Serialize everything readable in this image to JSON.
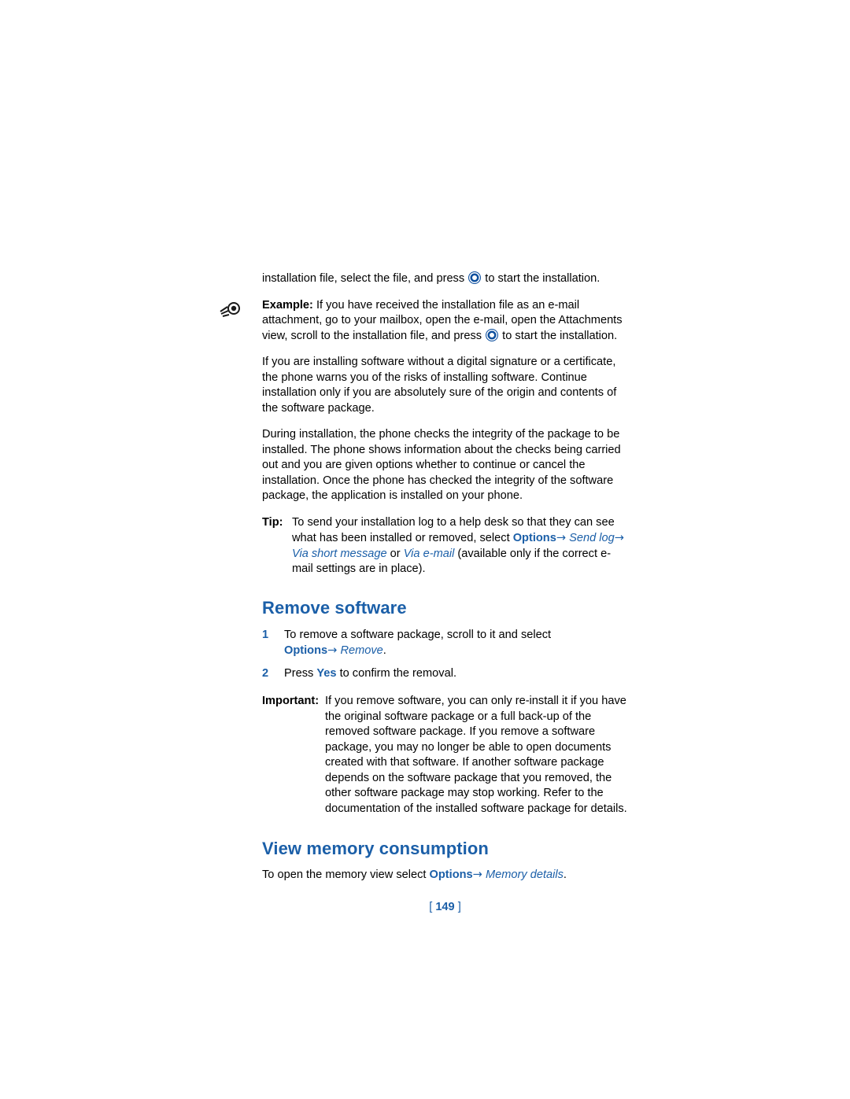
{
  "doc": {
    "intro_line_before": "installation file, select the file, and press",
    "intro_line_after": "to start the installation.",
    "example": {
      "label": "Example:",
      "text_1": " If you have received the installation file as an e-mail attachment, go to your mailbox, open the e-mail, open the Attachments view, scroll to the installation file, and press",
      "text_2": "to start the installation."
    },
    "para_warning": "If you are installing software without a digital signature or a certificate, the phone warns you of the risks of installing software. Continue installation only if you are absolutely sure of the origin and contents of the software package.",
    "para_integrity": "During installation, the phone checks the integrity of the package to be installed. The phone shows information about the checks being carried out and you are given options whether to continue or cancel the installation. Once the phone has checked the integrity of the software package, the application is installed on your phone.",
    "tip": {
      "label": "Tip:",
      "text_1": "To send your installation log to a help desk so that they can see what has been installed or removed, select ",
      "options": "Options",
      "arrow": "→",
      "send_log": "Send log",
      "via_short_message": "Via short message",
      "or": " or ",
      "via_email": "Via e-mail",
      "text_2": " (available only if the correct e-mail settings are in place)."
    },
    "heading_remove": "Remove software",
    "steps": [
      {
        "num": "1",
        "text_before": "To remove a software package, scroll to it and select ",
        "options": "Options",
        "arrow": "→",
        "action": "Remove",
        "text_after": "."
      },
      {
        "num": "2",
        "text_before": "Press ",
        "key": "Yes",
        "text_after": " to confirm the removal."
      }
    ],
    "important": {
      "label": "Important:",
      "text": "If you remove software, you can only re-install it if you have the original software package or a full back-up of the removed software package. If you remove a software package, you may no longer be able to open documents created with that software. If another software package depends on the software package that you removed, the other software package may stop working. Refer to the documentation of the installed software package for details."
    },
    "heading_memory": "View memory consumption",
    "memory_line": {
      "text_before": "To open the memory view select ",
      "options": "Options",
      "arrow": "→",
      "action": "Memory details",
      "text_after": "."
    },
    "page_number": "149",
    "bracket_open": "[",
    "bracket_close": "]"
  }
}
